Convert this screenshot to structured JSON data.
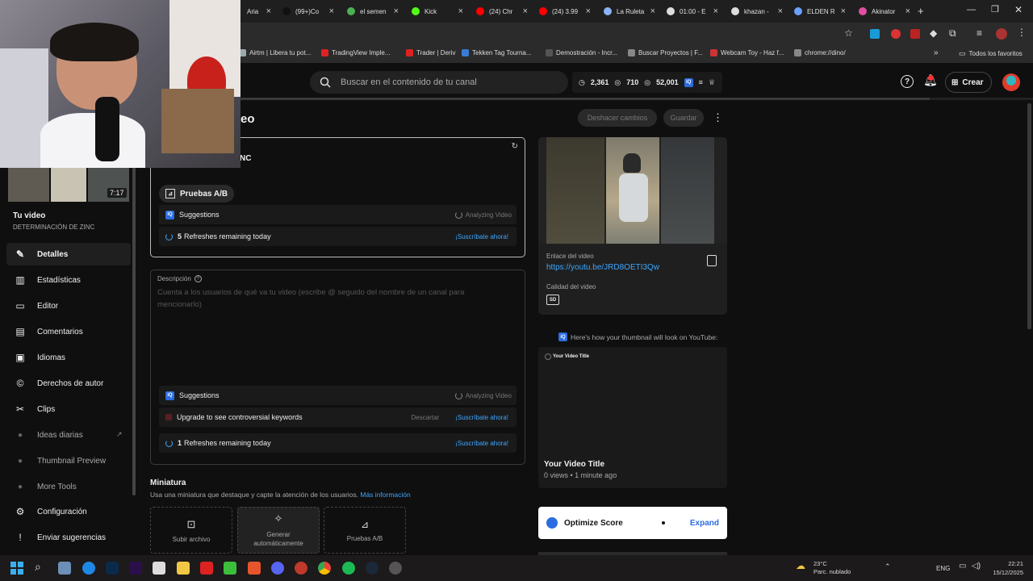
{
  "tabs": [
    {
      "label": "Aria",
      "color": "#c33"
    },
    {
      "label": "(99+)Co",
      "color": "#111"
    },
    {
      "label": "el semen",
      "color": "#4caf50"
    },
    {
      "label": "Kick",
      "color": "#53fc18"
    },
    {
      "label": "(24) Chr",
      "color": "#f00"
    },
    {
      "label": "(24) 3.99",
      "color": "#f00"
    },
    {
      "label": "La Ruleta",
      "color": "#8ab4f8"
    },
    {
      "label": "01:00 - E",
      "color": "#ddd"
    },
    {
      "label": "khazan -",
      "color": "#ddd"
    },
    {
      "label": "ELDEN R",
      "color": "#6aa0ff"
    },
    {
      "label": "Akinator",
      "color": "#e04fa0"
    }
  ],
  "bookmarks": [
    "Airtm | Libera tu pot...",
    "TradingView Imple...",
    "Trader | Deriv",
    "Tekken Tag Tourna...",
    "Demostración - Incr...",
    "Buscar Proyectos | F...",
    "Webcam Toy - Haz f...",
    "chrome://dino/"
  ],
  "bookmarks_all": "Todos los favoritos",
  "header": {
    "search_placeholder": "Buscar en el contenido de tu canal",
    "stat1": "2,361",
    "stat2": "710",
    "stat3": "52,001",
    "create_label": "Crear"
  },
  "video": {
    "duration": "7:17",
    "your_video": "Tu video",
    "title": "DETERMINACIÓN DE ZINC",
    "page_title_fragment": "eo",
    "title_fragment": "NC"
  },
  "nav": [
    {
      "label": "Detalles",
      "icon": "pencil-icon",
      "glyph": "✎",
      "active": true
    },
    {
      "label": "Estadísticas",
      "icon": "analytics-icon",
      "glyph": "▥"
    },
    {
      "label": "Editor",
      "icon": "editor-icon",
      "glyph": "▭"
    },
    {
      "label": "Comentarios",
      "icon": "comments-icon",
      "glyph": "▤"
    },
    {
      "label": "Idiomas",
      "icon": "subtitles-icon",
      "glyph": "▣"
    },
    {
      "label": "Derechos de autor",
      "icon": "copyright-icon",
      "glyph": "©"
    },
    {
      "label": "Clips",
      "icon": "scissors-icon",
      "glyph": "✂"
    },
    {
      "label": "Ideas diarias",
      "icon": "ideas-icon",
      "glyph": "●",
      "dim": true
    },
    {
      "label": "Thumbnail Preview",
      "icon": "thumbnail-icon",
      "glyph": "●",
      "dim": true
    },
    {
      "label": "More Tools",
      "icon": "tools-icon",
      "glyph": "●",
      "dim": true
    },
    {
      "label": "Configuración",
      "icon": "gear-icon",
      "glyph": "⚙"
    },
    {
      "label": "Enviar sugerencias",
      "icon": "feedback-icon",
      "glyph": "!"
    }
  ],
  "actions": {
    "undo": "Deshacer cambios",
    "save": "Guardar"
  },
  "ab_test": {
    "label": "Pruebas A/B"
  },
  "title_suggestions": {
    "label": "Suggestions",
    "status": "Analyzing Video",
    "refresh_count": "5",
    "refresh_text": "Refreshes remaining today",
    "subscribe": "¡Suscríbate ahora!"
  },
  "description": {
    "label": "Descripción",
    "placeholder": "Cuenta a los usuarios de qué va tu video (escribe @ seguido del nombre de un canal para mencionarlo)"
  },
  "desc_suggestions": {
    "label": "Suggestions",
    "status": "Analyzing Video",
    "upgrade": "Upgrade to see controversial keywords",
    "discard": "Descartar",
    "subscribe": "¡Suscríbate ahora!",
    "refresh_count": "1",
    "refresh_text": "Refreshes remaining today",
    "subscribe2": "¡Suscríbate ahora!"
  },
  "thumbnail": {
    "heading": "Miniatura",
    "help": "Usa una miniatura que destaque y capte la atención de los usuarios.",
    "more_info": "Más información",
    "upload": "Subir archivo",
    "auto": "Generar automáticamente",
    "ab": "Pruebas A/B"
  },
  "video_panel": {
    "link_label": "Enlace del video",
    "link": "https://youtu.be/JRD8OETI3Qw",
    "quality_label": "Calidad del video",
    "quality": "SD"
  },
  "preview": {
    "heading": "Here's how your thumbnail will look on YouTube:",
    "alt": "Your Video Title",
    "title": "Your Video Title",
    "meta": "0 views • 1 minute ago"
  },
  "optimize": {
    "label": "Optimize Score",
    "expand": "Expand"
  },
  "taskbar": {
    "weather_temp": "23°C",
    "weather_desc": "Parc. nublado",
    "lang": "ENG",
    "time": "22:21",
    "date": "15/12/2025"
  }
}
